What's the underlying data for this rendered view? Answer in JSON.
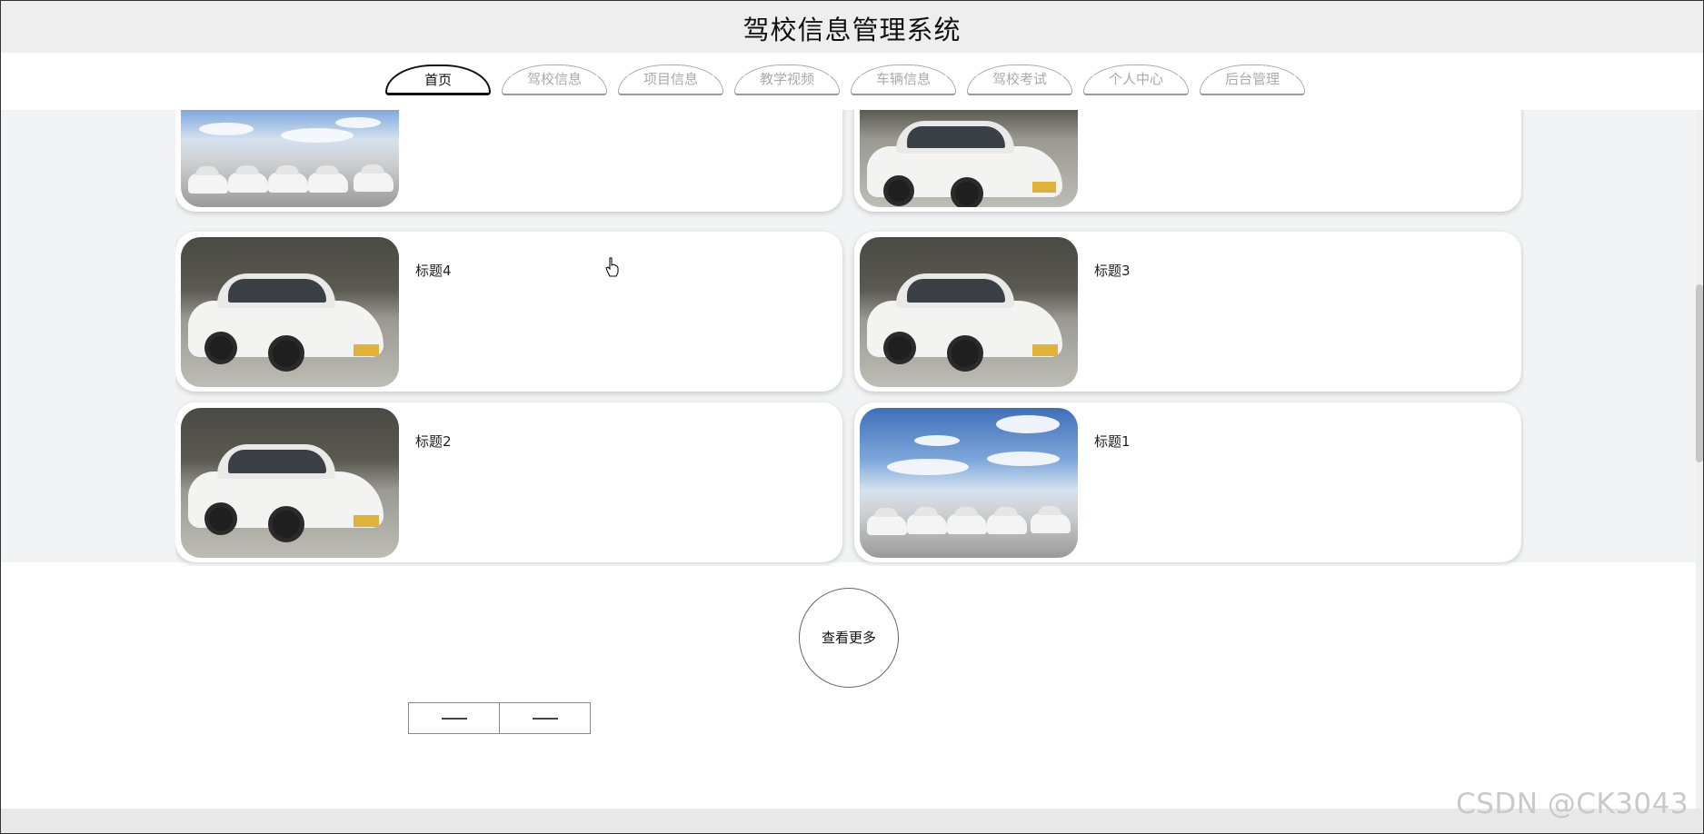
{
  "header": {
    "title": "驾校信息管理系统"
  },
  "nav": {
    "items": [
      {
        "label": "首页",
        "active": true
      },
      {
        "label": "驾校信息",
        "active": false
      },
      {
        "label": "项目信息",
        "active": false
      },
      {
        "label": "教学视频",
        "active": false
      },
      {
        "label": "车辆信息",
        "active": false
      },
      {
        "label": "驾校考试",
        "active": false
      },
      {
        "label": "个人中心",
        "active": false
      },
      {
        "label": "后台管理",
        "active": false
      }
    ]
  },
  "cards": [
    {
      "title": "",
      "photo": "car-lot-photo"
    },
    {
      "title": "",
      "photo": "sedan-photo"
    },
    {
      "title": "标题4",
      "photo": "sedan-photo"
    },
    {
      "title": "标题3",
      "photo": "sedan-photo"
    },
    {
      "title": "标题2",
      "photo": "sedan-photo"
    },
    {
      "title": "标题1",
      "photo": "car-lot-photo"
    }
  ],
  "more_button": {
    "label": "查看更多"
  },
  "pager": {
    "prev_icon": "dash-icon",
    "next_icon": "dash-icon"
  },
  "watermark": "CSDN @CK3043",
  "colors": {
    "topbar": "#eeeeee",
    "band": "#f2f3f4",
    "active_nav": "#111111",
    "inactive_nav": "#aaaaaa"
  }
}
